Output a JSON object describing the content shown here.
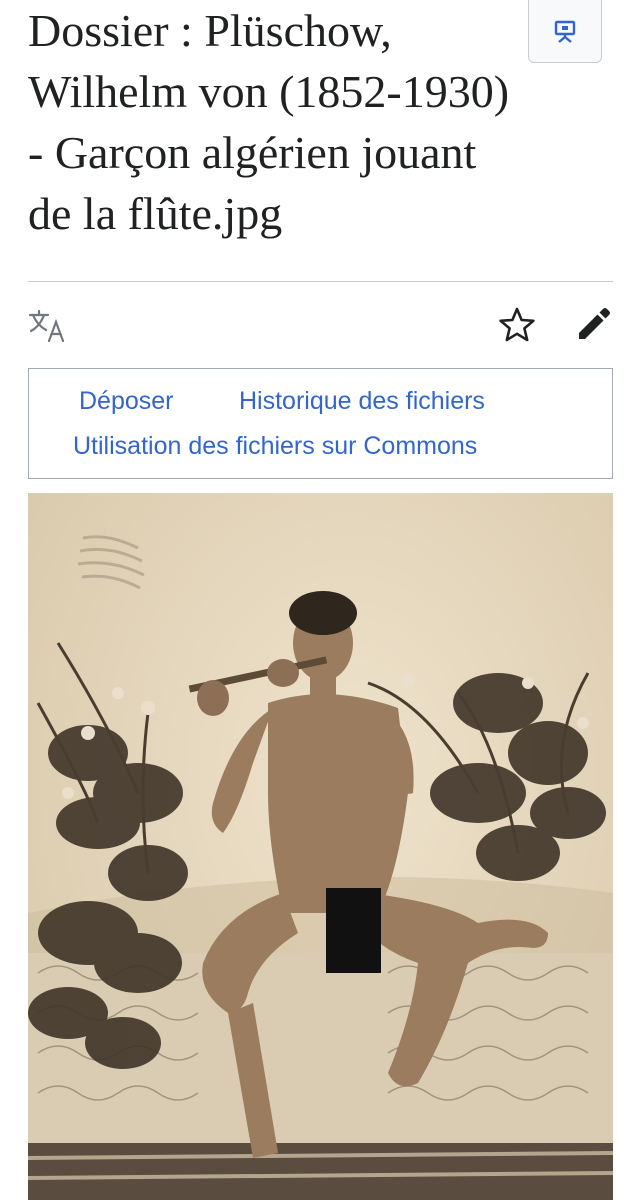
{
  "page": {
    "title": "Dossier : Plüschow, Wilhelm von (1852-1930) - Garçon algérien jouant de la flûte.jpg"
  },
  "toolbar": {
    "language_icon": "translate-icon",
    "watch_icon": "star-icon",
    "edit_icon": "pencil-icon",
    "corner_icon": "presentation-icon"
  },
  "nav": {
    "upload": "Déposer",
    "history": "Historique des fichiers",
    "usage": "Utilisation des fichiers sur Commons"
  },
  "colors": {
    "link": "#3366cc",
    "text": "#202122",
    "border": "#a2a9b1"
  }
}
